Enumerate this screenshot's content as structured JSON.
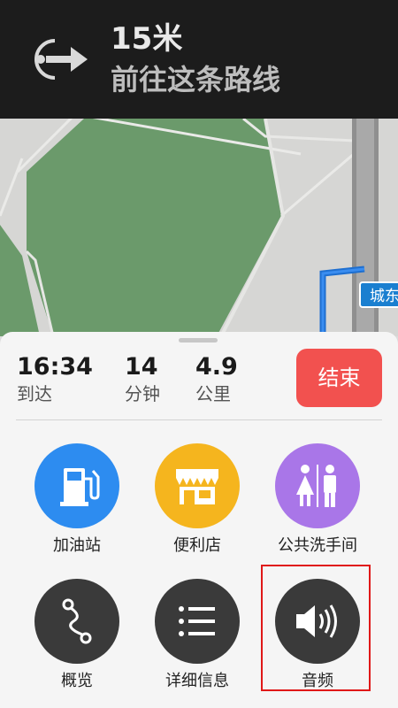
{
  "nav": {
    "icon": "exit-arrow-icon",
    "distance": "15米",
    "instruction": "前往这条路线"
  },
  "map": {
    "road_label": "城东"
  },
  "trip": {
    "arrival_time": "16:34",
    "arrival_label": "到达",
    "duration": "14",
    "duration_label": "分钟",
    "distance": "4.9",
    "distance_label": "公里",
    "end_button": "结束"
  },
  "actions": [
    {
      "label": "加油站",
      "icon": "gas-station-icon",
      "color": "#2d8cf0"
    },
    {
      "label": "便利店",
      "icon": "convenience-store-icon",
      "color": "#f5b51e"
    },
    {
      "label": "公共洗手间",
      "icon": "restroom-icon",
      "color": "#a976e8"
    },
    {
      "label": "概览",
      "icon": "route-overview-icon",
      "color": "#3a3a3a"
    },
    {
      "label": "详细信息",
      "icon": "list-icon",
      "color": "#3a3a3a"
    },
    {
      "label": "音频",
      "icon": "speaker-icon",
      "color": "#3a3a3a"
    }
  ]
}
